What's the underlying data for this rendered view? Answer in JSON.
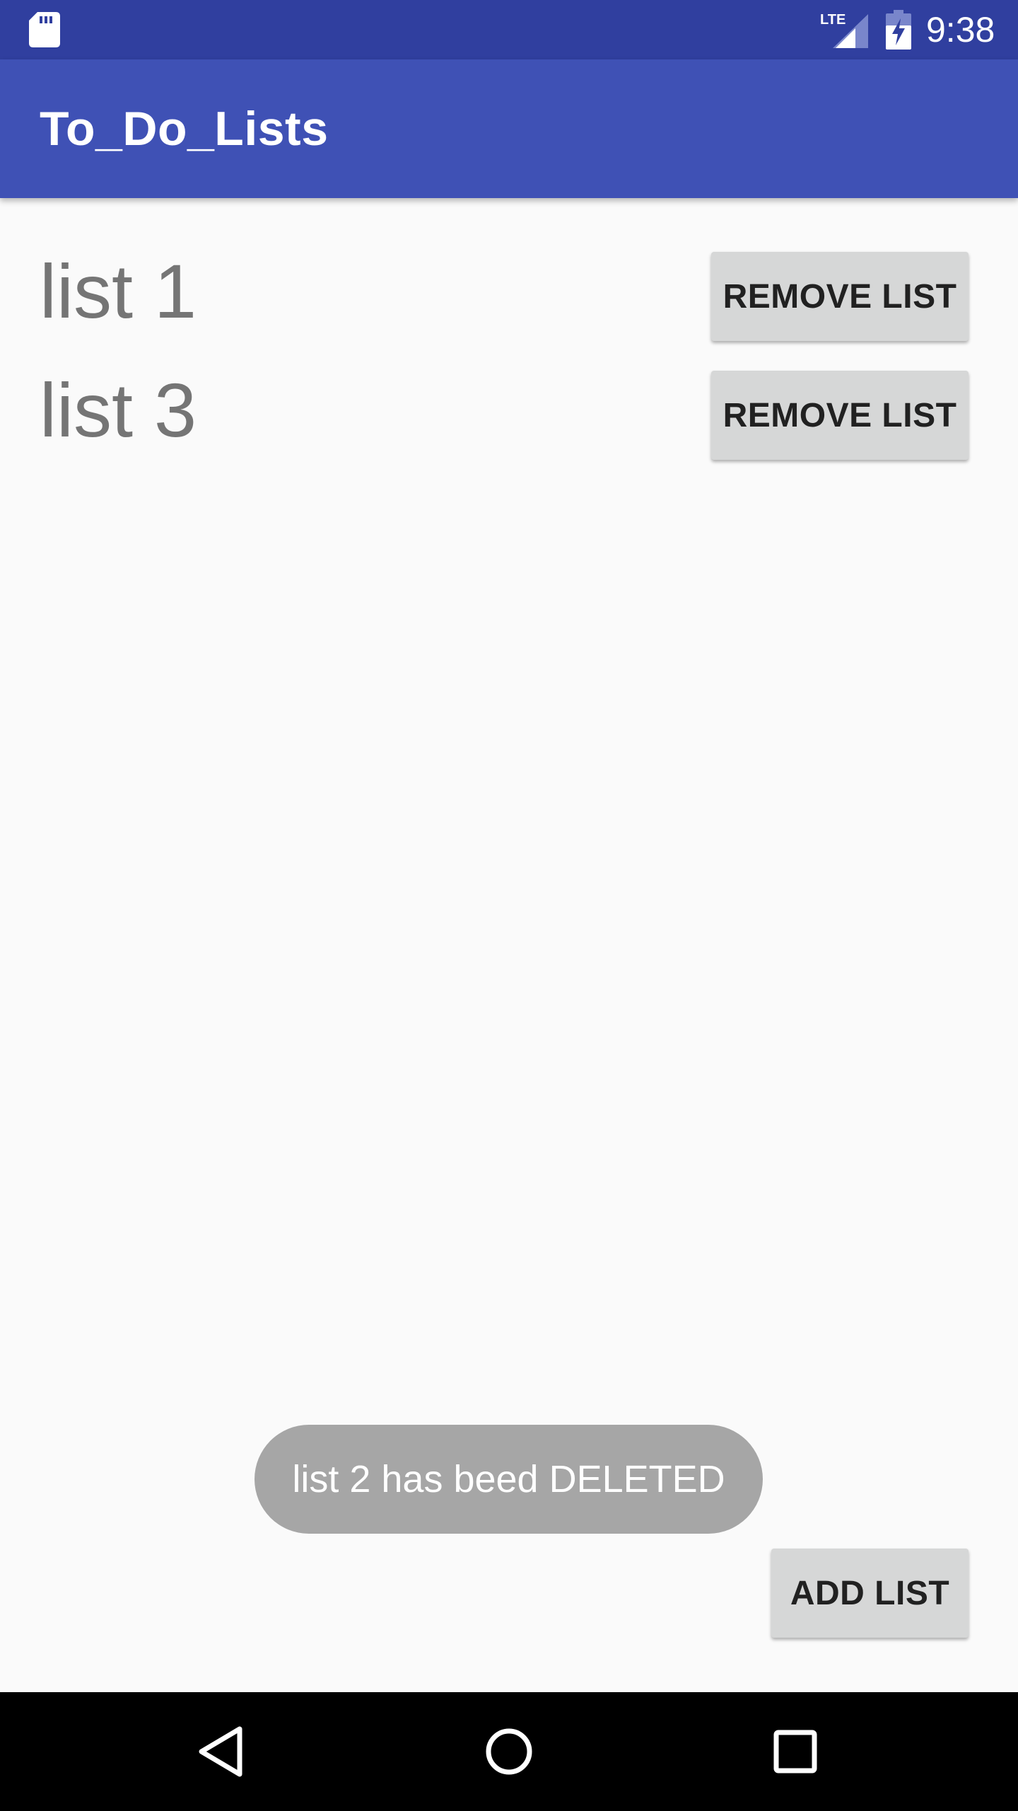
{
  "status_bar": {
    "time": "9:38",
    "network": "LTE",
    "icons": [
      "sd-card-icon",
      "lte-signal-icon",
      "battery-charging-icon"
    ]
  },
  "app_bar": {
    "title": "To_Do_Lists"
  },
  "lists": [
    {
      "name": "list 1",
      "remove_label": "REMOVE LIST"
    },
    {
      "name": "list 3",
      "remove_label": "REMOVE LIST"
    }
  ],
  "toast": {
    "message": "list 2 has beed DELETED"
  },
  "add_button": {
    "label": "ADD LIST"
  },
  "nav_bar": {
    "icons": [
      "back-icon",
      "home-icon",
      "recents-icon"
    ]
  },
  "colors": {
    "status_bar": "#303f9f",
    "app_bar": "#3f51b5",
    "background": "#fafafa",
    "button": "#d6d7d7",
    "toast": "#a6a6a6",
    "list_text": "#757575"
  }
}
